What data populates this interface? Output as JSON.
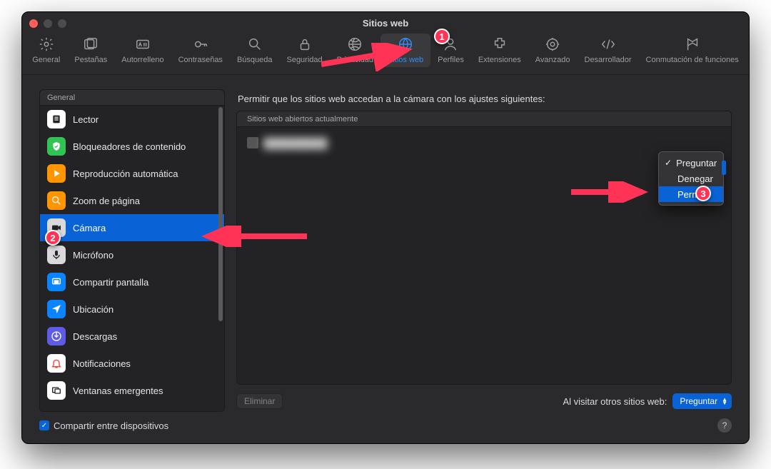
{
  "window": {
    "title": "Sitios web"
  },
  "toolbar": [
    {
      "id": "general",
      "label": "General"
    },
    {
      "id": "tabs",
      "label": "Pestañas"
    },
    {
      "id": "autofill",
      "label": "Autorrelleno"
    },
    {
      "id": "passwords",
      "label": "Contraseñas"
    },
    {
      "id": "search",
      "label": "Búsqueda"
    },
    {
      "id": "security",
      "label": "Seguridad"
    },
    {
      "id": "privacy",
      "label": "Privacidad"
    },
    {
      "id": "websites",
      "label": "Sitios web",
      "selected": true
    },
    {
      "id": "profiles",
      "label": "Perfiles"
    },
    {
      "id": "extensions",
      "label": "Extensiones"
    },
    {
      "id": "advanced",
      "label": "Avanzado"
    },
    {
      "id": "developer",
      "label": "Desarrollador"
    },
    {
      "id": "featureflags",
      "label": "Conmutación de funciones"
    }
  ],
  "sidebar": {
    "header": "General",
    "items": [
      {
        "id": "reader",
        "label": "Lector",
        "icon": "reader",
        "bg": "#ffffff",
        "fg": "#222"
      },
      {
        "id": "blockers",
        "label": "Bloqueadores de contenido",
        "icon": "shield",
        "bg": "#31c455",
        "fg": "#fff"
      },
      {
        "id": "autoplay",
        "label": "Reproducción automática",
        "icon": "play",
        "bg": "#ff9500",
        "fg": "#fff"
      },
      {
        "id": "zoom",
        "label": "Zoom de página",
        "icon": "zoom",
        "bg": "#ff9500",
        "fg": "#fff"
      },
      {
        "id": "camera",
        "label": "Cámara",
        "icon": "camera",
        "bg": "#d9d9db",
        "fg": "#222",
        "selected": true
      },
      {
        "id": "mic",
        "label": "Micrófono",
        "icon": "mic",
        "bg": "#d9d9db",
        "fg": "#222"
      },
      {
        "id": "screenshare",
        "label": "Compartir pantalla",
        "icon": "screens",
        "bg": "#0a84ff",
        "fg": "#fff"
      },
      {
        "id": "location",
        "label": "Ubicación",
        "icon": "location",
        "bg": "#0a84ff",
        "fg": "#fff"
      },
      {
        "id": "downloads",
        "label": "Descargas",
        "icon": "download",
        "bg": "#5e5ce6",
        "fg": "#fff"
      },
      {
        "id": "notifications",
        "label": "Notificaciones",
        "icon": "bell",
        "bg": "#ffffff",
        "fg": "#ff3b30"
      },
      {
        "id": "popups",
        "label": "Ventanas emergentes",
        "icon": "popup",
        "bg": "#ffffff",
        "fg": "#222"
      }
    ]
  },
  "main": {
    "heading": "Permitir que los sitios web accedan a la cámara con los ajustes siguientes:",
    "list_header": "Sitios web abiertos actualmente",
    "site_name_placeholder": "████████",
    "dropdown": {
      "items": [
        {
          "label": "Preguntar",
          "checked": true
        },
        {
          "label": "Denegar"
        },
        {
          "label": "Permitir",
          "highlight": true
        }
      ]
    },
    "remove_button": "Eliminar",
    "visiting_label": "Al visitar otros sitios web:",
    "visiting_value": "Preguntar"
  },
  "footer": {
    "share_label": "Compartir entre dispositivos",
    "share_checked": true
  },
  "callouts": {
    "one": "1",
    "two": "2",
    "three": "3"
  }
}
